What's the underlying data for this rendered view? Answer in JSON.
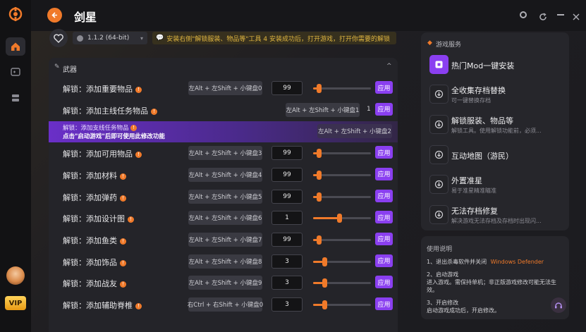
{
  "header": {
    "title": "剑星",
    "version": "1.1.2 (64-bit)",
    "notice": "安装右侧\"解锁服装、物品等\"工具 4 安装成功后，打开游戏，打开你需要的解锁"
  },
  "panel": {
    "section": "武器",
    "rows": [
      {
        "label": "解锁：添加重要物品",
        "hotkey": "左Alt + 左Shift + 小键盘0",
        "value": "99",
        "slider": 0.1,
        "apply": "应用"
      },
      {
        "label": "解锁：添加主线任务物品",
        "hotkey": "左Alt + 左Shift + 小键盘1",
        "value": "1",
        "apply": "应用"
      },
      {
        "label": "解锁：添加支线任务物品",
        "hotkey": "左Alt + 左Shift + 小键盘2",
        "overlay": "点击\"启动游戏\"后即可使用此修改功能"
      },
      {
        "label": "解锁：添加可用物品",
        "hotkey": "左Alt + 左Shift + 小键盘3",
        "value": "99",
        "slider": 0.1,
        "apply": "应用"
      },
      {
        "label": "解锁：添加材料",
        "hotkey": "左Alt + 左Shift + 小键盘4",
        "value": "99",
        "slider": 0.1,
        "apply": "应用"
      },
      {
        "label": "解锁：添加弹药",
        "hotkey": "左Alt + 左Shift + 小键盘5",
        "value": "99",
        "slider": 0.1,
        "apply": "应用"
      },
      {
        "label": "解锁：添加设计图",
        "hotkey": "左Alt + 左Shift + 小键盘6",
        "value": "1",
        "slider": 0.45,
        "apply": "应用"
      },
      {
        "label": "解锁：添加鱼类",
        "hotkey": "左Alt + 左Shift + 小键盘7",
        "value": "99",
        "slider": 0.1,
        "apply": "应用"
      },
      {
        "label": "解锁：添加饰品",
        "hotkey": "左Alt + 左Shift + 小键盘8",
        "value": "3",
        "slider": 0.2,
        "apply": "应用"
      },
      {
        "label": "解锁：添加战友",
        "hotkey": "左Alt + 左Shift + 小键盘9",
        "value": "3",
        "slider": 0.2,
        "apply": "应用"
      },
      {
        "label": "解锁：添加辅助脊椎",
        "hotkey": "右Ctrl + 右Shift + 小键盘0",
        "value": "3",
        "slider": 0.2,
        "apply": "应用"
      }
    ]
  },
  "services": {
    "title": "游戏服务",
    "items": [
      {
        "title": "热门Mod一键安装",
        "sub": ""
      },
      {
        "title": "全收集存档替换",
        "sub": "可一键替换存档"
      },
      {
        "title": "解锁服装、物品等",
        "sub": "解锁工具。使用解锁功能前，必须..."
      },
      {
        "title": "互动地图（游民）",
        "sub": ""
      },
      {
        "title": "外置准星",
        "sub": "易于准星精准瞄准"
      },
      {
        "title": "无法存档修复",
        "sub": "解决游戏无法存档及存档时出现闪..."
      }
    ]
  },
  "usage": {
    "title": "使用说明",
    "step1_title": "1、退出杀毒软件并关闭",
    "step1_highlight": "Windows Defender",
    "step2_title": "2、启动游戏",
    "step2_line1": "进入游戏。需保持单机；非正版游戏修改可能无法生",
    "step2_line2": "效。",
    "step3_title": "3、开启修改",
    "step3_line1": "启动游戏成功后，开启修改。"
  },
  "vip_label": "VIP",
  "colors": {
    "accent": "#f07a2a",
    "purple": "#8a3ff0"
  }
}
